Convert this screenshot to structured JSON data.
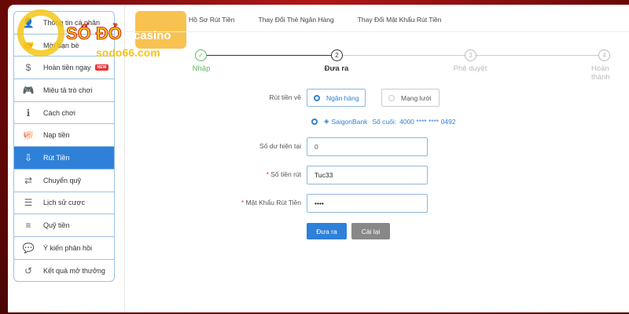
{
  "sidebar": {
    "items": [
      {
        "label": "Thông tin cá nhân",
        "icon": "user-icon"
      },
      {
        "label": "Mời bạn bè",
        "icon": "handshake-icon"
      },
      {
        "label": "Hoàn tiền ngay",
        "icon": "cashback-icon",
        "badge": "NEW"
      },
      {
        "label": "Miêu tả trò chơi",
        "icon": "gamepad-icon"
      },
      {
        "label": "Cách chơi",
        "icon": "info-icon"
      },
      {
        "label": "Nạp tiền",
        "icon": "piggy-bank-icon"
      },
      {
        "label": "Rút Tiền",
        "icon": "withdraw-icon",
        "active": true
      },
      {
        "label": "Chuyển quỹ",
        "icon": "transfer-icon"
      },
      {
        "label": "Lịch sử cược",
        "icon": "history-list-icon"
      },
      {
        "label": "Quỹ tiền",
        "icon": "coins-icon"
      },
      {
        "label": "Ý kiến phản hồi",
        "icon": "feedback-icon"
      },
      {
        "label": "Kết quả mở thưởng",
        "icon": "clock-history-icon"
      }
    ]
  },
  "logo": {
    "text": "SỐ ĐỎ casino",
    "domain": "sodo66.com"
  },
  "tabs": [
    "Hồ Sơ Rút Tiền",
    "Thay Đổi Thẻ Ngân Hàng",
    "Thay Đổi Mật Khẩu Rút Tiền"
  ],
  "steps": [
    {
      "num": "✓",
      "label": "Nhập",
      "state": "done"
    },
    {
      "num": "2",
      "label": "Đưa ra",
      "state": "current"
    },
    {
      "num": "3",
      "label": "Phê duyệt",
      "state": "pending"
    },
    {
      "num": "4",
      "label": "Hoàn thành",
      "state": "pending"
    }
  ],
  "form": {
    "withdraw_to_label": "Rút tiền về",
    "options": [
      "Ngân hàng",
      "Mạng lưới"
    ],
    "bank": {
      "name": "SaigonBank",
      "last_label": "Số cuối:",
      "number": "4000 **** **** 0492"
    },
    "balance_label": "Số dư hiện tại",
    "balance_value": "0",
    "amount_label": "Số tiền rút",
    "amount_value": "Tuc33",
    "password_label": "Mật Khẩu Rút Tiền",
    "password_value": "••••",
    "submit": "Đưa ra",
    "reset": "Cài lại"
  },
  "colors": {
    "accent": "#2f80d9",
    "success": "#5cb85c",
    "background": "#8a0d0d"
  }
}
